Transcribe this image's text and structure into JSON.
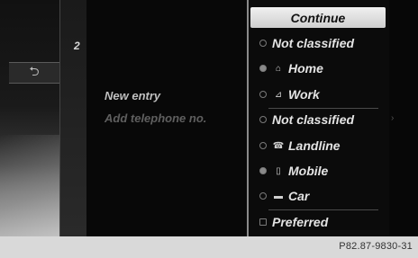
{
  "left": {
    "page_number": "2",
    "back_icon": "back-arrow-icon"
  },
  "entry": {
    "title": "New entry",
    "subtitle": "Add telephone no."
  },
  "menu": {
    "continue_label": "Continue",
    "items": [
      {
        "label": "Not classified",
        "bullet": "empty",
        "icon": ""
      },
      {
        "label": "Home",
        "bullet": "filled",
        "icon": "home-icon"
      },
      {
        "label": "Work",
        "bullet": "empty",
        "icon": "work-icon"
      },
      {
        "label": "Not classified",
        "bullet": "empty",
        "icon": ""
      },
      {
        "label": "Landline",
        "bullet": "empty",
        "icon": "landline-icon"
      },
      {
        "label": "Mobile",
        "bullet": "filled",
        "icon": "mobile-icon"
      },
      {
        "label": "Car",
        "bullet": "empty",
        "icon": "car-icon"
      },
      {
        "label": "Preferred",
        "bullet": "checkbox",
        "icon": ""
      }
    ]
  },
  "footer": {
    "code": "P82.87-9830-31"
  }
}
